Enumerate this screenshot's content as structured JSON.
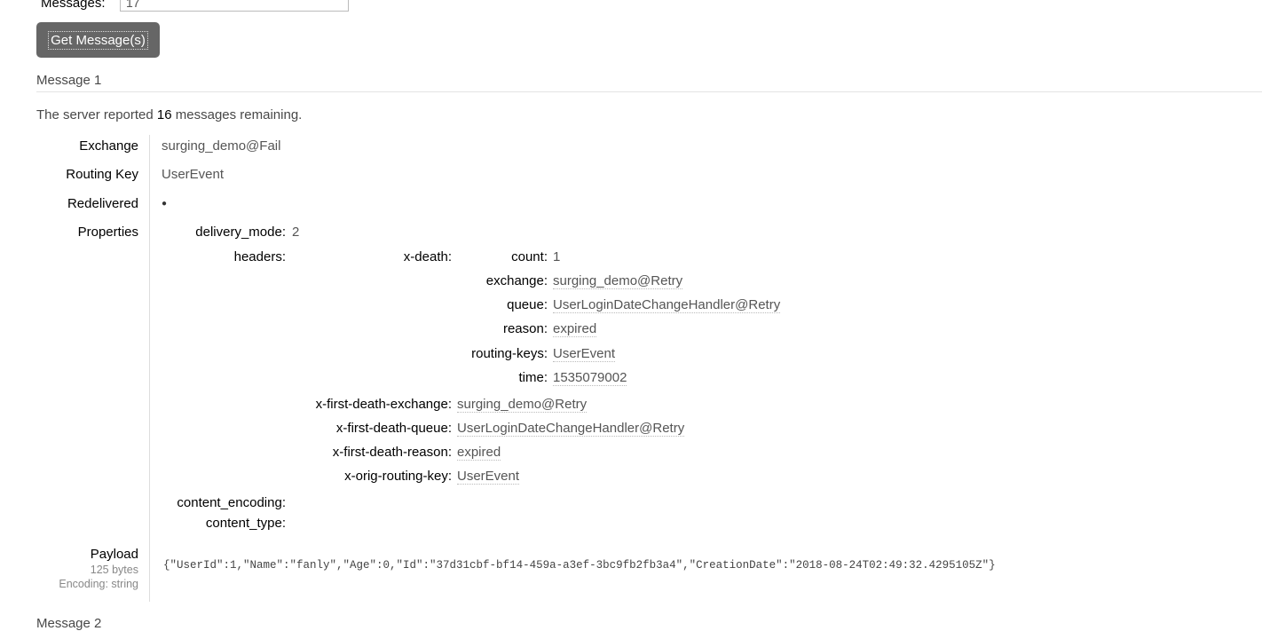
{
  "form": {
    "messages_label": "Messages:",
    "messages_value": "17",
    "get_button": "Get Message(s)"
  },
  "message1": {
    "heading": "Message 1",
    "remaining_prefix": "The server reported",
    "remaining_count": "16",
    "remaining_suffix": "messages remaining.",
    "fields": {
      "exchange_label": "Exchange",
      "exchange_value": "surging_demo@Fail",
      "routing_key_label": "Routing Key",
      "routing_key_value": "UserEvent",
      "redelivered_label": "Redelivered",
      "redelivered_value": "●",
      "properties_label": "Properties"
    },
    "properties": {
      "delivery_mode_label": "delivery_mode:",
      "delivery_mode_value": "2",
      "headers_label": "headers:",
      "x_death_label": "x-death:",
      "x_death": [
        {
          "key": "count:",
          "value": "1"
        },
        {
          "key": "exchange:",
          "value": "surging_demo@Retry"
        },
        {
          "key": "queue:",
          "value": "UserLoginDateChangeHandler@Retry"
        },
        {
          "key": "reason:",
          "value": "expired"
        },
        {
          "key": "routing-keys:",
          "value": "UserEvent"
        },
        {
          "key": "time:",
          "value": "1535079002"
        }
      ],
      "headers_extra": [
        {
          "key": "x-first-death-exchange:",
          "value": "surging_demo@Retry"
        },
        {
          "key": "x-first-death-queue:",
          "value": "UserLoginDateChangeHandler@Retry"
        },
        {
          "key": "x-first-death-reason:",
          "value": "expired"
        },
        {
          "key": "x-orig-routing-key:",
          "value": "UserEvent"
        }
      ],
      "content_encoding_label": "content_encoding:",
      "content_type_label": "content_type:"
    },
    "payload": {
      "label": "Payload",
      "size": "125 bytes",
      "encoding": "Encoding: string",
      "body": "{\"UserId\":1,\"Name\":\"fanly\",\"Age\":0,\"Id\":\"37d31cbf-bf14-459a-a3ef-3bc9fb2fb3a4\",\"CreationDate\":\"2018-08-24T02:49:32.4295105Z\"}"
    }
  },
  "message2": {
    "heading": "Message 2"
  }
}
